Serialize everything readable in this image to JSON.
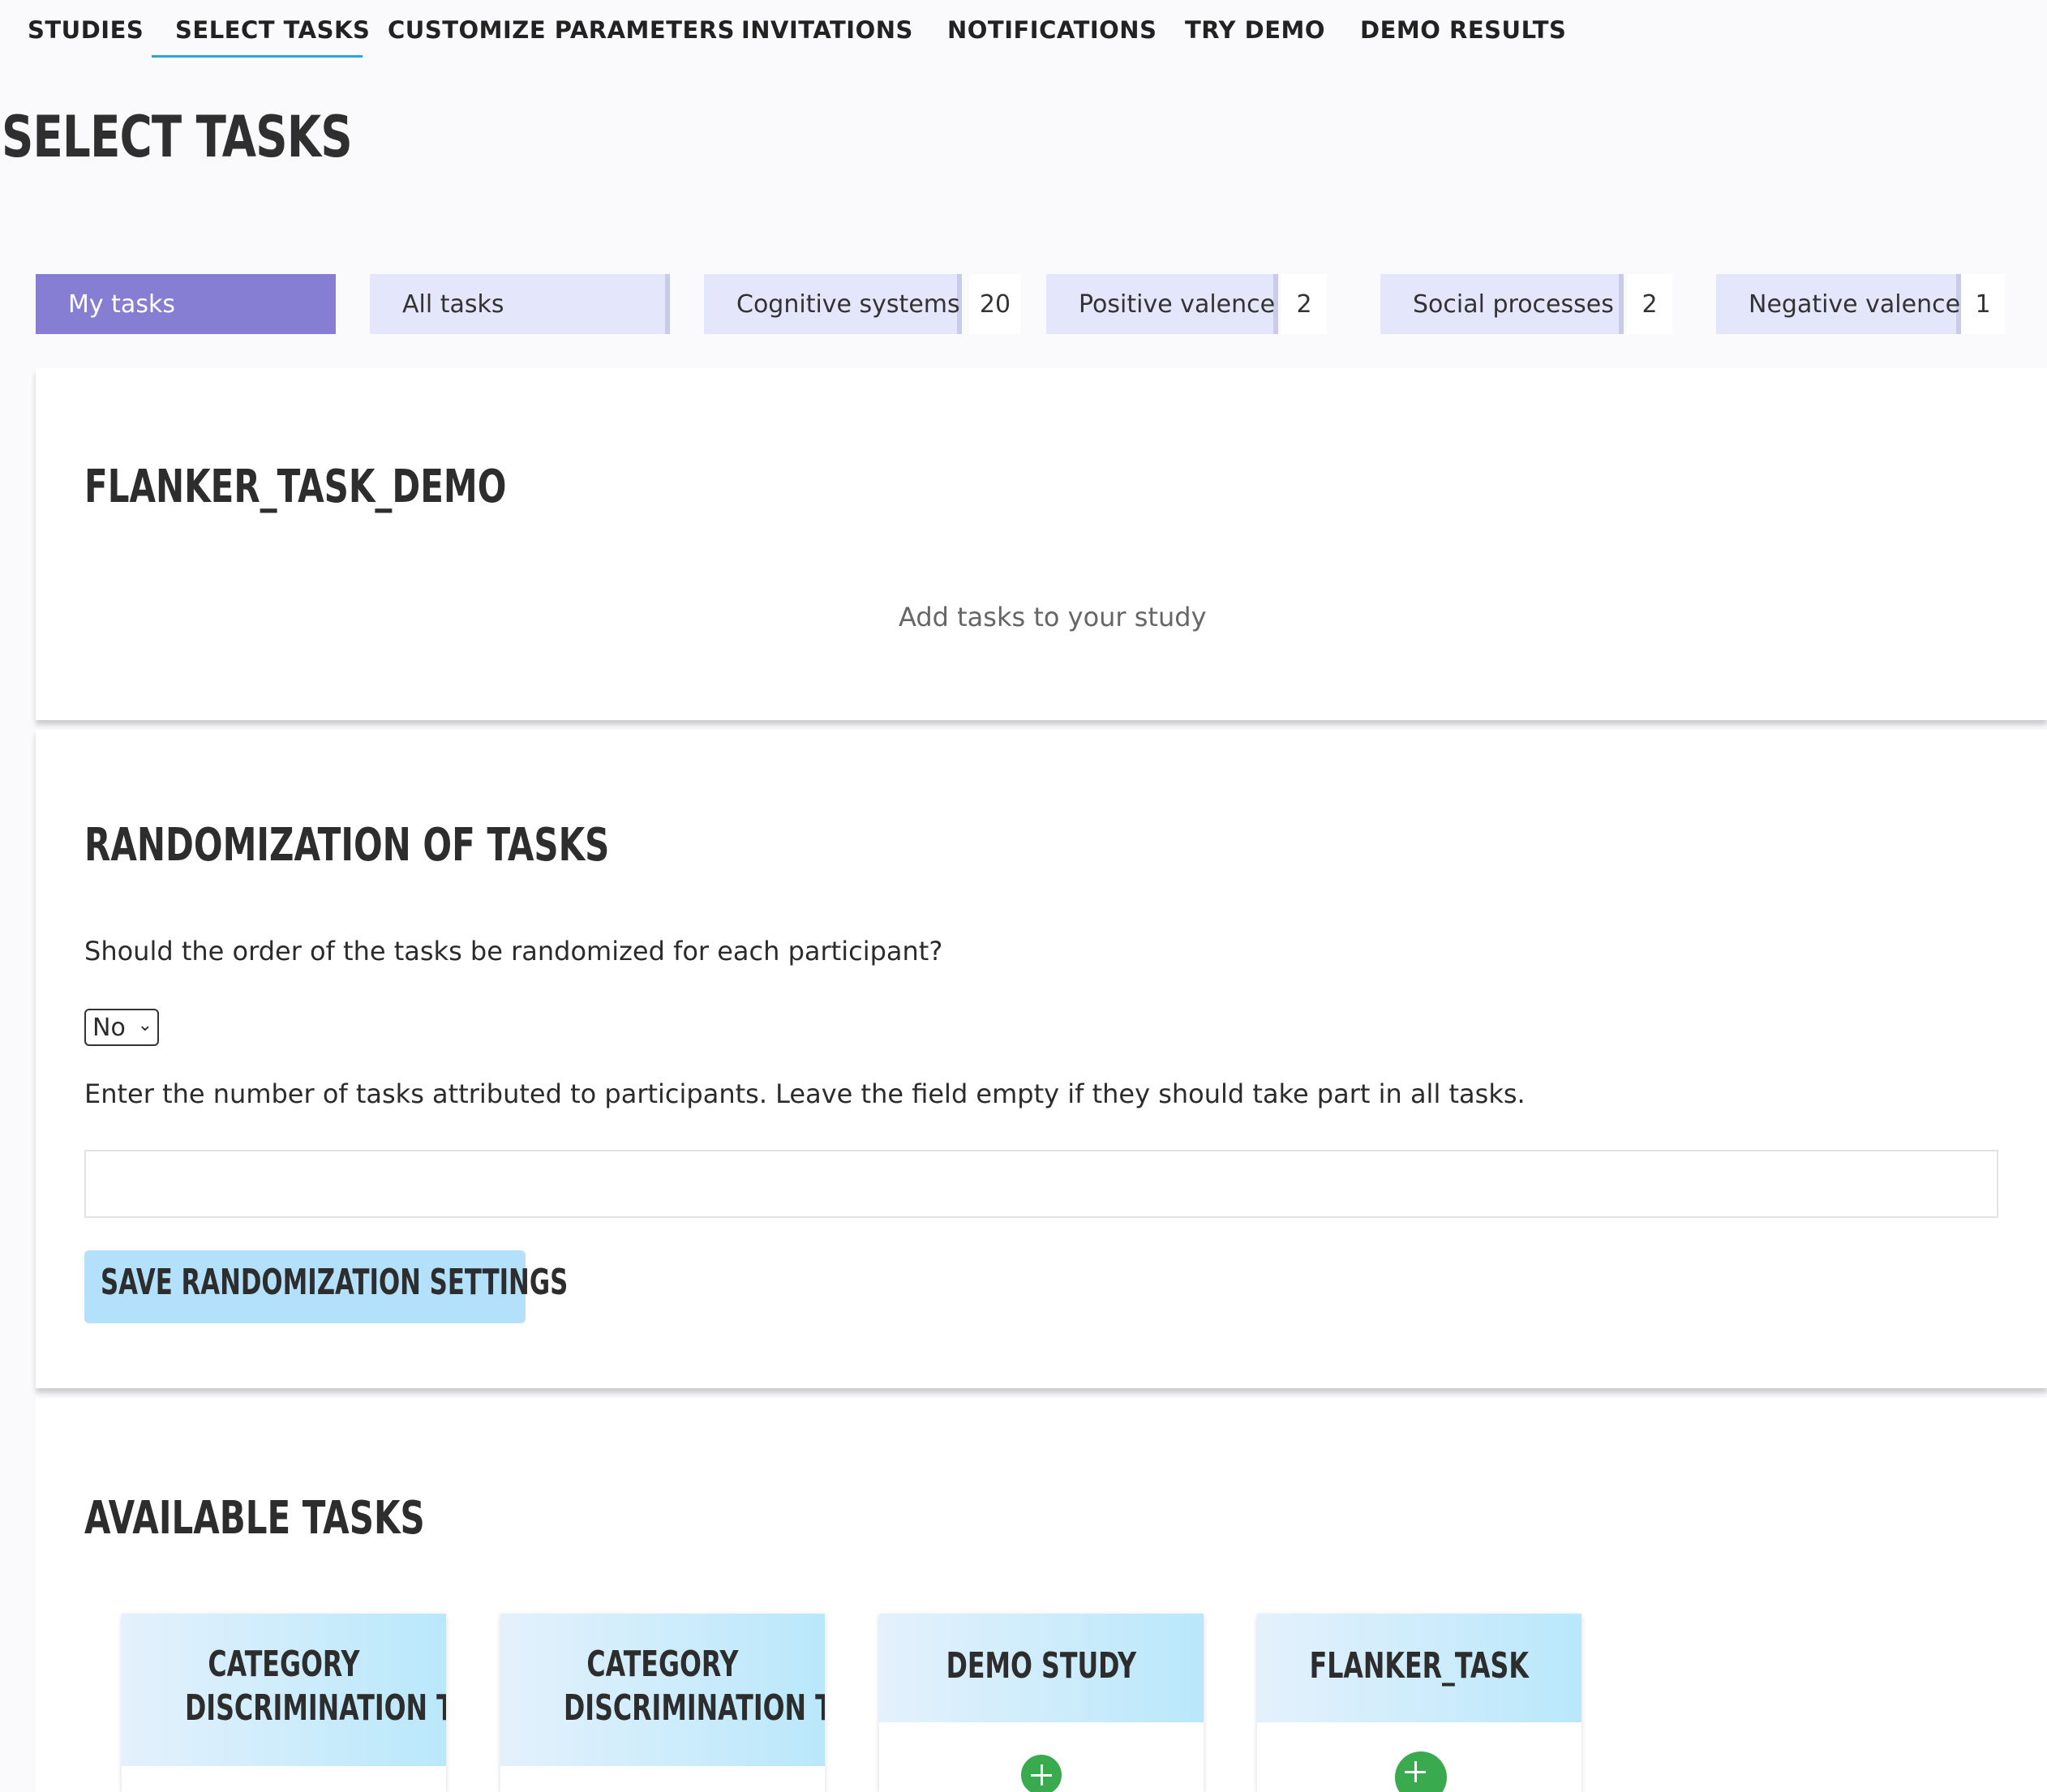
{
  "nav": {
    "items": [
      {
        "label": "STUDIES"
      },
      {
        "label": "SELECT TASKS"
      },
      {
        "label": "CUSTOMIZE PARAMETERS"
      },
      {
        "label": "INVITATIONS"
      },
      {
        "label": "NOTIFICATIONS"
      },
      {
        "label": "TRY DEMO"
      },
      {
        "label": "DEMO RESULTS"
      }
    ],
    "active": "SELECT TASKS",
    "underline_color": "#27a3e6"
  },
  "page": {
    "title": "SELECT TASKS"
  },
  "filters": [
    {
      "label": "My tasks",
      "count": "",
      "active": true
    },
    {
      "label": "All tasks",
      "count": ""
    },
    {
      "label": "Cognitive systems",
      "count": "20"
    },
    {
      "label": "Positive valence",
      "count": "2"
    },
    {
      "label": "Social processes",
      "count": "2"
    },
    {
      "label": "Negative valence",
      "count": "1"
    }
  ],
  "colors": {
    "active_filter": "#857ed2",
    "filter_bg": "#e4e6fc",
    "save_button": "#b3e0fb",
    "add_icon": "#3aaa4e"
  },
  "study": {
    "title": "FLANKER_TASK_DEMO",
    "empty_message": "Add tasks to your study"
  },
  "randomization": {
    "title": "RANDOMIZATION OF TASKS",
    "question": "Should the order of the tasks be randomized for each participant?",
    "select_value": "No",
    "number_prompt": "Enter the number of tasks attributed to participants. Leave the field empty if they should take part in all tasks.",
    "number_value": "",
    "save_label": "SAVE RANDOMIZATION SETTINGS"
  },
  "available": {
    "title": "AVAILABLE TASKS",
    "tasks": [
      {
        "name_line1": "CATEGORY",
        "name_line2": "DISCRIMINATION TASK"
      },
      {
        "name_line1": "CATEGORY",
        "name_line2": "DISCRIMINATION TASK"
      },
      {
        "name_line1": "DEMO STUDY",
        "name_line2": ""
      },
      {
        "name_line1": "FLANKER_TASK",
        "name_line2": ""
      }
    ],
    "add_icon": "plus-circle-icon"
  }
}
